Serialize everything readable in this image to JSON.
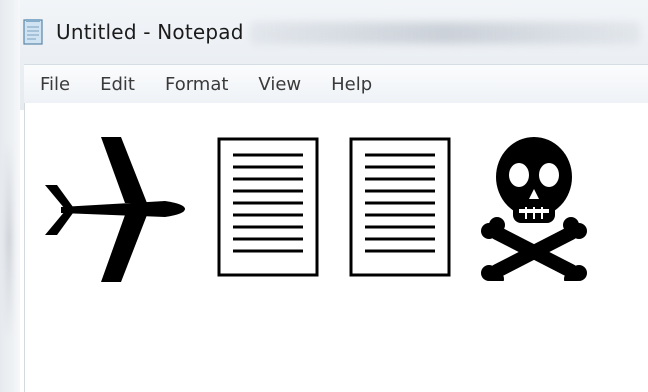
{
  "window": {
    "title": "Untitled - Notepad",
    "app_icon": "notepad-icon"
  },
  "menubar": {
    "items": [
      {
        "label": "File"
      },
      {
        "label": "Edit"
      },
      {
        "label": "Format"
      },
      {
        "label": "View"
      },
      {
        "label": "Help"
      }
    ]
  },
  "document": {
    "glyphs": [
      {
        "icon": "airplane-icon"
      },
      {
        "icon": "document-icon"
      },
      {
        "icon": "document-icon"
      },
      {
        "icon": "skull-and-crossbones-icon"
      }
    ]
  },
  "colors": {
    "glyph": "#000000",
    "menu_text": "#3a3a3a",
    "title_text": "#1b1b1b"
  }
}
